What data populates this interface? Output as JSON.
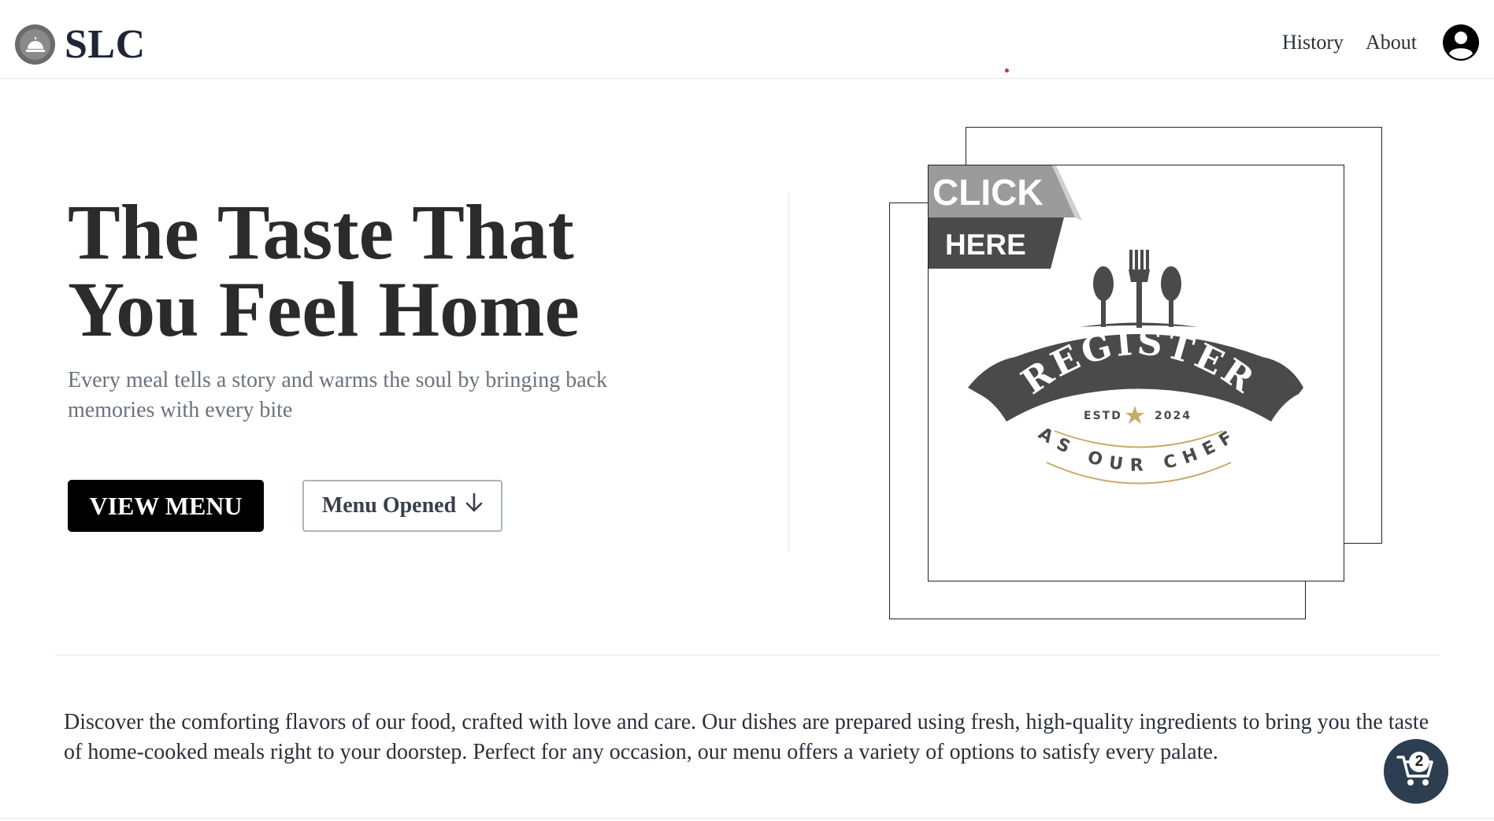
{
  "nav": {
    "brand": "SLC",
    "links": [
      "History",
      "About"
    ]
  },
  "hero": {
    "title_line1": "The Taste That",
    "title_line2": "You Feel Home",
    "subtitle": "Every meal tells a story and warms the soul by bringing back memories with every bite",
    "primary_button": "VIEW MENU",
    "secondary_button": "Menu Opened"
  },
  "promo": {
    "ribbon_top": "CLICK",
    "ribbon_bottom": "HERE",
    "banner": "REGISTER",
    "estd": "ESTD",
    "year": "2024",
    "tagline": "AS OUR CHEF"
  },
  "description": "Discover the comforting flavors of our food, crafted with love and care. Our dishes are prepared using fresh, high-quality ingredients to bring you the taste of home-cooked meals right to your doorstep. Perfect for any occasion, our menu offers a variety of options to satisfy every palate.",
  "cart": {
    "count": "2"
  },
  "colors": {
    "brand_dark": "#1f2537",
    "cart_bg": "#2c3e50",
    "accent_gold": "#c8a96a",
    "logo_gray": "#4a4a4a"
  },
  "icons": [
    "cloche-icon",
    "user-circle-icon",
    "arrow-down-icon",
    "utensils-icon",
    "star-icon",
    "cart-icon"
  ]
}
